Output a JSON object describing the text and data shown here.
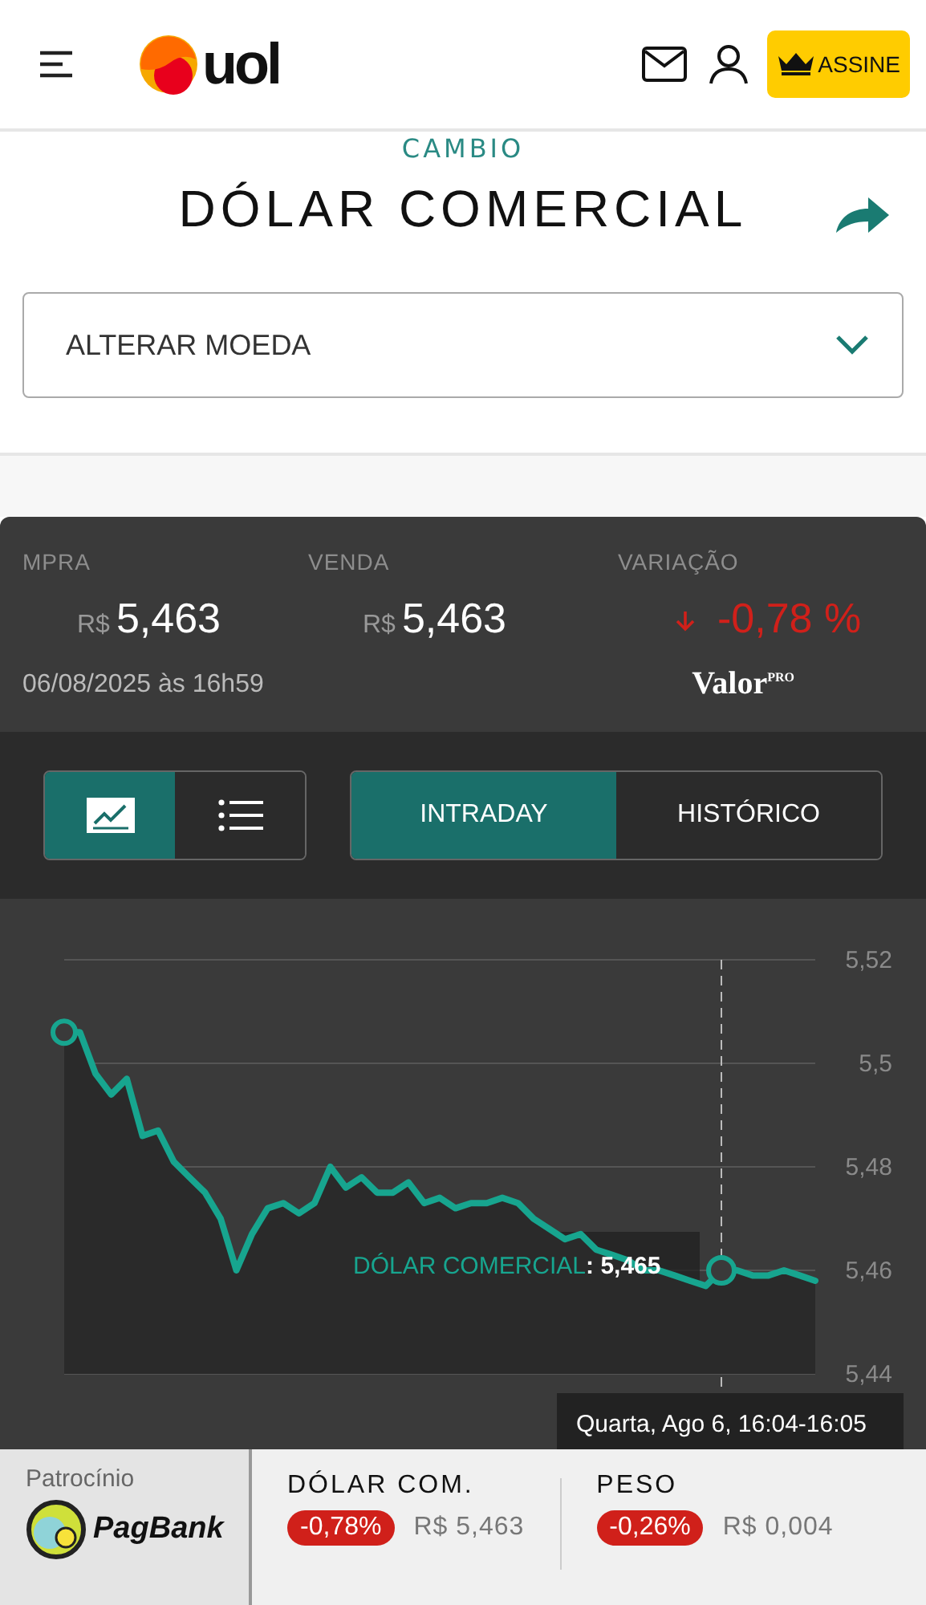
{
  "header": {
    "logo_text": "uol",
    "subscribe_button": "ASSINE"
  },
  "section_label": "CAMBIO",
  "title": "DÓLAR COMERCIAL",
  "currency_select": {
    "value": "ALTERAR MOEDA"
  },
  "quotes": [
    {
      "label": "MPRA",
      "prefix": "R$",
      "value": "5,463"
    },
    {
      "label": "VENDA",
      "prefix": "R$",
      "value": "5,463"
    }
  ],
  "variation": {
    "label": "VARIAÇÃO",
    "value": "-0,78 %"
  },
  "updated": "06/08/2025 às 16h59",
  "source_logo": {
    "name": "Valor",
    "tag": "PRO"
  },
  "view_toggles": [
    {
      "kind": "chart",
      "selected": true
    },
    {
      "kind": "list",
      "selected": false
    }
  ],
  "tabs": [
    {
      "label": "INTRADAY",
      "selected": true
    },
    {
      "label": "HISTÓRICO",
      "selected": false
    }
  ],
  "chart_data": {
    "type": "area",
    "grid": true,
    "ylim": [
      5.44,
      5.52
    ],
    "yticks": [
      {
        "value": 5.52,
        "label": "5,52"
      },
      {
        "value": 5.5,
        "label": "5,5"
      },
      {
        "value": 5.48,
        "label": "5,48"
      },
      {
        "value": 5.46,
        "label": "5,46"
      },
      {
        "value": 5.44,
        "label": "5,44"
      }
    ],
    "series": [
      {
        "name": "DÓLAR COMERCIAL",
        "color": "#17a58f",
        "values": [
          5.506,
          5.506,
          5.498,
          5.494,
          5.497,
          5.486,
          5.487,
          5.481,
          5.478,
          5.475,
          5.47,
          5.46,
          5.467,
          5.472,
          5.473,
          5.471,
          5.473,
          5.48,
          5.476,
          5.478,
          5.475,
          5.475,
          5.477,
          5.473,
          5.474,
          5.472,
          5.473,
          5.473,
          5.474,
          5.473,
          5.47,
          5.468,
          5.466,
          5.467,
          5.464,
          5.463,
          5.462,
          5.46,
          5.46,
          5.459,
          5.458,
          5.457,
          5.46,
          5.46,
          5.459,
          5.459,
          5.46,
          5.459,
          5.458
        ]
      }
    ]
  },
  "tooltip": {
    "value": ": 5,465"
  },
  "crosshair_label": "Quarta, Ago 6, 16:04-16:05",
  "ticker": {
    "sponsor_label": "Patrocínio",
    "sponsor": "PagBank",
    "items": [
      {
        "name": "DÓLAR COM.",
        "change": "-0,78%",
        "price": "R$ 5,463"
      },
      {
        "name": "PESO",
        "change": "-0,26%",
        "price": "R$ 0,004"
      }
    ]
  }
}
